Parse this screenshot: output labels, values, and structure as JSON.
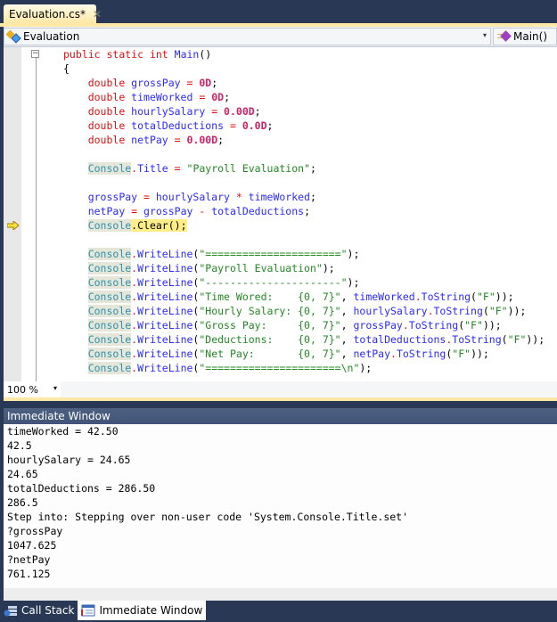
{
  "document_tab": {
    "title": "Evaluation.cs*",
    "close_glyph": "✕"
  },
  "navigation": {
    "class_selector": {
      "value": "Evaluation",
      "icon": "class-icon",
      "arrow": "▾"
    },
    "member_selector": {
      "value": "Main()",
      "icon": "method-icon"
    }
  },
  "editor": {
    "collapse_glyph": "−",
    "current_line_index": 12,
    "lines": [
      {
        "indent": 0,
        "tokens": [
          [
            "kw",
            "public "
          ],
          [
            "kw",
            "static "
          ],
          [
            "kw",
            "int "
          ],
          [
            "id",
            "Main"
          ],
          [
            "punc",
            "()"
          ]
        ]
      },
      {
        "indent": 0,
        "tokens": [
          [
            "punc",
            "{"
          ]
        ]
      },
      {
        "indent": 1,
        "tokens": [
          [
            "kw",
            "double "
          ],
          [
            "id",
            "grossPay"
          ],
          [
            "op",
            " = "
          ],
          [
            "num",
            "0D"
          ],
          [
            "punc",
            ";"
          ]
        ]
      },
      {
        "indent": 1,
        "tokens": [
          [
            "kw",
            "double "
          ],
          [
            "id",
            "timeWorked"
          ],
          [
            "op",
            " = "
          ],
          [
            "num",
            "0D"
          ],
          [
            "punc",
            ";"
          ]
        ]
      },
      {
        "indent": 1,
        "tokens": [
          [
            "kw",
            "double "
          ],
          [
            "id",
            "hourlySalary"
          ],
          [
            "op",
            " = "
          ],
          [
            "num",
            "0.00D"
          ],
          [
            "punc",
            ";"
          ]
        ]
      },
      {
        "indent": 1,
        "tokens": [
          [
            "kw",
            "double "
          ],
          [
            "id",
            "totalDeductions"
          ],
          [
            "op",
            " = "
          ],
          [
            "num",
            "0.0D"
          ],
          [
            "punc",
            ";"
          ]
        ]
      },
      {
        "indent": 1,
        "tokens": [
          [
            "kw",
            "double "
          ],
          [
            "id",
            "netPay"
          ],
          [
            "op",
            " = "
          ],
          [
            "num",
            "0.00D"
          ],
          [
            "punc",
            ";"
          ]
        ]
      },
      {
        "indent": 1,
        "tokens": []
      },
      {
        "indent": 1,
        "tokens": [
          [
            "cls",
            "Console"
          ],
          [
            "op",
            "."
          ],
          [
            "mem",
            "Title"
          ],
          [
            "op",
            " = "
          ],
          [
            "str",
            "\"Payroll Evaluation\""
          ],
          [
            "punc",
            ";"
          ]
        ]
      },
      {
        "indent": 1,
        "tokens": []
      },
      {
        "indent": 1,
        "tokens": [
          [
            "id",
            "grossPay"
          ],
          [
            "op",
            " = "
          ],
          [
            "id",
            "hourlySalary"
          ],
          [
            "op",
            " * "
          ],
          [
            "id",
            "timeWorked"
          ],
          [
            "punc",
            ";"
          ]
        ]
      },
      {
        "indent": 1,
        "tokens": [
          [
            "id",
            "netPay"
          ],
          [
            "op",
            " = "
          ],
          [
            "id",
            "grossPay"
          ],
          [
            "op",
            " - "
          ],
          [
            "id",
            "totalDeductions"
          ],
          [
            "punc",
            ";"
          ]
        ]
      },
      {
        "indent": 1,
        "tokens": [
          [
            "cls",
            "Console"
          ],
          [
            "hl",
            "."
          ],
          [
            "hl",
            "Clear();"
          ]
        ]
      },
      {
        "indent": 1,
        "tokens": []
      },
      {
        "indent": 1,
        "tokens": [
          [
            "cls",
            "Console"
          ],
          [
            "op",
            "."
          ],
          [
            "mem",
            "WriteLine"
          ],
          [
            "punc",
            "("
          ],
          [
            "str",
            "\"======================\""
          ],
          [
            "punc",
            ");"
          ]
        ]
      },
      {
        "indent": 1,
        "tokens": [
          [
            "cls",
            "Console"
          ],
          [
            "op",
            "."
          ],
          [
            "mem",
            "WriteLine"
          ],
          [
            "punc",
            "("
          ],
          [
            "str",
            "\"Payroll Evaluation\""
          ],
          [
            "punc",
            ");"
          ]
        ]
      },
      {
        "indent": 1,
        "tokens": [
          [
            "cls",
            "Console"
          ],
          [
            "op",
            "."
          ],
          [
            "mem",
            "WriteLine"
          ],
          [
            "punc",
            "("
          ],
          [
            "str",
            "\"----------------------\""
          ],
          [
            "punc",
            ");"
          ]
        ]
      },
      {
        "indent": 1,
        "tokens": [
          [
            "cls",
            "Console"
          ],
          [
            "op",
            "."
          ],
          [
            "mem",
            "WriteLine"
          ],
          [
            "punc",
            "("
          ],
          [
            "str",
            "\"Time Wored:    {0, 7}\""
          ],
          [
            "punc",
            ", "
          ],
          [
            "id",
            "timeWorked"
          ],
          [
            "op",
            "."
          ],
          [
            "mem",
            "ToString"
          ],
          [
            "punc",
            "("
          ],
          [
            "str",
            "\"F\""
          ],
          [
            "punc",
            "));"
          ]
        ]
      },
      {
        "indent": 1,
        "tokens": [
          [
            "cls",
            "Console"
          ],
          [
            "op",
            "."
          ],
          [
            "mem",
            "WriteLine"
          ],
          [
            "punc",
            "("
          ],
          [
            "str",
            "\"Hourly Salary: {0, 7}\""
          ],
          [
            "punc",
            ", "
          ],
          [
            "id",
            "hourlySalary"
          ],
          [
            "op",
            "."
          ],
          [
            "mem",
            "ToString"
          ],
          [
            "punc",
            "("
          ],
          [
            "str",
            "\"F\""
          ],
          [
            "punc",
            "));"
          ]
        ]
      },
      {
        "indent": 1,
        "tokens": [
          [
            "cls",
            "Console"
          ],
          [
            "op",
            "."
          ],
          [
            "mem",
            "WriteLine"
          ],
          [
            "punc",
            "("
          ],
          [
            "str",
            "\"Gross Pay:     {0, 7}\""
          ],
          [
            "punc",
            ", "
          ],
          [
            "id",
            "grossPay"
          ],
          [
            "op",
            "."
          ],
          [
            "mem",
            "ToString"
          ],
          [
            "punc",
            "("
          ],
          [
            "str",
            "\"F\""
          ],
          [
            "punc",
            "));"
          ]
        ]
      },
      {
        "indent": 1,
        "tokens": [
          [
            "cls",
            "Console"
          ],
          [
            "op",
            "."
          ],
          [
            "mem",
            "WriteLine"
          ],
          [
            "punc",
            "("
          ],
          [
            "str",
            "\"Deductions:    {0, 7}\""
          ],
          [
            "punc",
            ", "
          ],
          [
            "id",
            "totalDeductions"
          ],
          [
            "op",
            "."
          ],
          [
            "mem",
            "ToString"
          ],
          [
            "punc",
            "("
          ],
          [
            "str",
            "\"F\""
          ],
          [
            "punc",
            "));"
          ]
        ]
      },
      {
        "indent": 1,
        "tokens": [
          [
            "cls",
            "Console"
          ],
          [
            "op",
            "."
          ],
          [
            "mem",
            "WriteLine"
          ],
          [
            "punc",
            "("
          ],
          [
            "str",
            "\"Net Pay:       {0, 7}\""
          ],
          [
            "punc",
            ", "
          ],
          [
            "id",
            "netPay"
          ],
          [
            "op",
            "."
          ],
          [
            "mem",
            "ToString"
          ],
          [
            "punc",
            "("
          ],
          [
            "str",
            "\"F\""
          ],
          [
            "punc",
            "));"
          ]
        ]
      },
      {
        "indent": 1,
        "tokens": [
          [
            "cls",
            "Console"
          ],
          [
            "op",
            "."
          ],
          [
            "mem",
            "WriteLine"
          ],
          [
            "punc",
            "("
          ],
          [
            "str",
            "\"======================\\n\""
          ],
          [
            "punc",
            ");"
          ]
        ]
      }
    ]
  },
  "zoom": {
    "value": "100 %",
    "arrow": "▾"
  },
  "immediate_window": {
    "title": "Immediate Window",
    "lines": [
      "timeWorked = 42.50",
      "42.5",
      "hourlySalary = 24.65",
      "24.65",
      "totalDeductions = 286.50",
      "286.5",
      "Step into: Stepping over non-user code 'System.Console.Title.set'",
      "?grossPay",
      "1047.625",
      "?netPay",
      "761.125"
    ]
  },
  "bottom_tabs": [
    {
      "label": "Call Stack",
      "icon": "call-stack-icon",
      "active": false
    },
    {
      "label": "Immediate Window",
      "icon": "immediate-window-icon",
      "active": true
    }
  ]
}
